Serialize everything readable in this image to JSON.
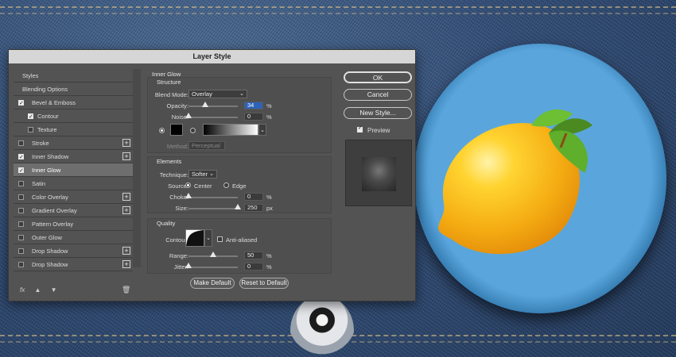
{
  "dialog": {
    "title": "Layer Style"
  },
  "left_panel": {
    "items": [
      {
        "label": "Styles",
        "checkbox": false,
        "checked": false,
        "plus": false,
        "selected": false,
        "indent": false
      },
      {
        "label": "Blending Options",
        "checkbox": false,
        "checked": false,
        "plus": false,
        "selected": false,
        "indent": false
      },
      {
        "label": "Bevel & Emboss",
        "checkbox": true,
        "checked": true,
        "plus": false,
        "selected": false,
        "indent": false
      },
      {
        "label": "Contour",
        "checkbox": true,
        "checked": true,
        "plus": false,
        "selected": false,
        "indent": true
      },
      {
        "label": "Texture",
        "checkbox": true,
        "checked": false,
        "plus": false,
        "selected": false,
        "indent": true
      },
      {
        "label": "Stroke",
        "checkbox": true,
        "checked": false,
        "plus": true,
        "selected": false,
        "indent": false
      },
      {
        "label": "Inner Shadow",
        "checkbox": true,
        "checked": true,
        "plus": true,
        "selected": false,
        "indent": false
      },
      {
        "label": "Inner Glow",
        "checkbox": true,
        "checked": true,
        "plus": false,
        "selected": true,
        "indent": false
      },
      {
        "label": "Satin",
        "checkbox": true,
        "checked": false,
        "plus": false,
        "selected": false,
        "indent": false
      },
      {
        "label": "Color Overlay",
        "checkbox": true,
        "checked": false,
        "plus": true,
        "selected": false,
        "indent": false
      },
      {
        "label": "Gradient Overlay",
        "checkbox": true,
        "checked": false,
        "plus": true,
        "selected": false,
        "indent": false
      },
      {
        "label": "Pattern Overlay",
        "checkbox": true,
        "checked": false,
        "plus": false,
        "selected": false,
        "indent": false
      },
      {
        "label": "Outer Glow",
        "checkbox": true,
        "checked": false,
        "plus": false,
        "selected": false,
        "indent": false
      },
      {
        "label": "Drop Shadow",
        "checkbox": true,
        "checked": false,
        "plus": true,
        "selected": false,
        "indent": false
      },
      {
        "label": "Drop Shadow",
        "checkbox": true,
        "checked": false,
        "plus": true,
        "selected": false,
        "indent": false
      }
    ],
    "bottom_icons": [
      "fx",
      "▲",
      "▼"
    ]
  },
  "inner_glow": {
    "title": "Inner Glow",
    "structure": {
      "title": "Structure",
      "blend_mode_label": "Blend Mode:",
      "blend_mode_value": "Overlay",
      "opacity_label": "Opacity:",
      "opacity_value": "34",
      "opacity_fraction": 0.34,
      "noise_label": "Noise:",
      "noise_value": "0",
      "noise_fraction": 0,
      "percent": "%"
    },
    "elements": {
      "title": "Elements",
      "technique_label": "Technique:",
      "technique_value": "Softer",
      "source_label": "Source:",
      "source_center": "Center",
      "source_edge": "Edge",
      "choke_label": "Choke:",
      "choke_value": "0",
      "choke_fraction": 0,
      "size_label": "Size:",
      "size_value": "250",
      "size_fraction": 1.0,
      "px": "px"
    },
    "method_label": "Method:",
    "method_value": "Perceptual",
    "quality": {
      "title": "Quality",
      "contour_label": "Contour:",
      "anti_aliased_label": "Anti-aliased",
      "range_label": "Range:",
      "range_value": "50",
      "range_fraction": 0.5,
      "jitter_label": "Jitter:",
      "jitter_value": "0",
      "jitter_fraction": 0
    },
    "make_default": "Make Default",
    "reset_default": "Reset to Default"
  },
  "right_buttons": {
    "ok": "OK",
    "cancel": "Cancel",
    "new_style": "New Style...",
    "preview_label": "Preview",
    "preview_checked": true
  },
  "colors": {
    "dialog_bg": "#535353",
    "selected_row": "#6e6e6e",
    "highlight_field": "#2d62b8",
    "lemon": "#f7b51a",
    "badge_blue": "#5aa6dc"
  }
}
